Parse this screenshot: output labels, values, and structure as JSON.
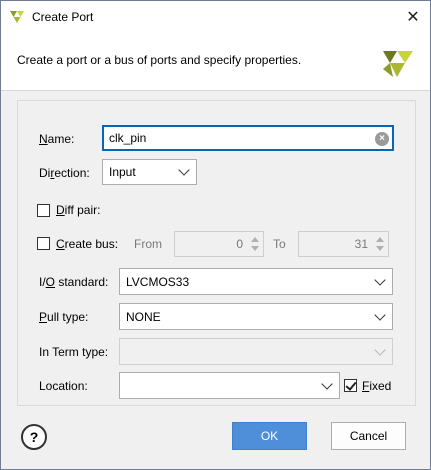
{
  "window": {
    "title": "Create Port",
    "close_glyph": "✕",
    "accent": "#0a64b8"
  },
  "header": {
    "description": "Create a port or a bus of ports and specify properties."
  },
  "form": {
    "name": {
      "label_u": "N",
      "label_rest": "ame:",
      "value": "clk_pin"
    },
    "direction": {
      "label_pre": "Di",
      "label_u": "r",
      "label_post": "ection:",
      "value": "Input"
    },
    "diff_pair": {
      "label_u": "D",
      "label_rest": "iff pair:",
      "checked": false
    },
    "create_bus": {
      "label_u": "C",
      "label_rest": "reate bus:",
      "checked": false,
      "from_label": "From",
      "from_value": "0",
      "to_label": "To",
      "to_value": "31"
    },
    "io_standard": {
      "label_pre": "I/",
      "label_u": "O",
      "label_post": " standard:",
      "value": "LVCMOS33"
    },
    "pull_type": {
      "label_u": "P",
      "label_rest": "ull type:",
      "value": "NONE"
    },
    "in_term_type": {
      "label": "In Term type:",
      "value": ""
    },
    "location": {
      "label": "Location:",
      "value": ""
    },
    "fixed": {
      "label_u": "F",
      "label_rest": "ixed",
      "checked": true
    }
  },
  "footer": {
    "help_label": "?",
    "ok_label": "OK",
    "cancel_label": "Cancel",
    "ok_color": "#4f8fd9"
  },
  "icons": [
    "vivado-logo-icon",
    "close-icon",
    "clear-icon",
    "chevron-down-icon",
    "help-icon"
  ]
}
